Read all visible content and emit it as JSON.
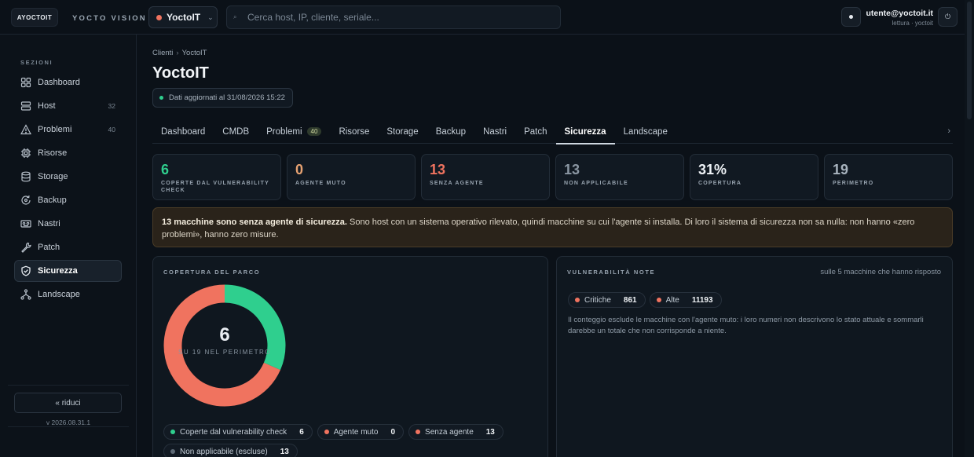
{
  "header": {
    "logo_text": "AYOCTOIT",
    "brand": "YOCTO VISION",
    "client": "YoctoIT",
    "search_placeholder": "Cerca host, IP, cliente, seriale...",
    "user_email": "utente@yoctoit.it",
    "user_role": "lettura · yoctoit"
  },
  "sidebar": {
    "section_title": "SEZIONI",
    "items": [
      {
        "label": "Dashboard",
        "icon": "grid-icon",
        "count": ""
      },
      {
        "label": "Host",
        "icon": "server-icon",
        "count": "32"
      },
      {
        "label": "Problemi",
        "icon": "warning-icon",
        "count": "40"
      },
      {
        "label": "Risorse",
        "icon": "cpu-icon",
        "count": ""
      },
      {
        "label": "Storage",
        "icon": "database-icon",
        "count": ""
      },
      {
        "label": "Backup",
        "icon": "backup-icon",
        "count": ""
      },
      {
        "label": "Nastri",
        "icon": "tape-icon",
        "count": ""
      },
      {
        "label": "Patch",
        "icon": "wrench-icon",
        "count": ""
      },
      {
        "label": "Sicurezza",
        "icon": "shield-icon",
        "count": ""
      },
      {
        "label": "Landscape",
        "icon": "network-icon",
        "count": ""
      }
    ],
    "active": "Sicurezza",
    "collapse_label": "« riduci",
    "version": "v 2026.08.31.1"
  },
  "main": {
    "breadcrumb": {
      "root": "Clienti",
      "current": "YoctoIT"
    },
    "title": "YoctoIT",
    "updated": "Dati aggiornati al 31/08/2026 15:22",
    "tabs": [
      {
        "label": "Dashboard",
        "badge": ""
      },
      {
        "label": "CMDB",
        "badge": ""
      },
      {
        "label": "Problemi",
        "badge": "40"
      },
      {
        "label": "Risorse",
        "badge": ""
      },
      {
        "label": "Storage",
        "badge": ""
      },
      {
        "label": "Backup",
        "badge": ""
      },
      {
        "label": "Nastri",
        "badge": ""
      },
      {
        "label": "Patch",
        "badge": ""
      },
      {
        "label": "Sicurezza",
        "badge": ""
      },
      {
        "label": "Landscape",
        "badge": ""
      }
    ],
    "active_tab": "Sicurezza",
    "stats": [
      {
        "value": "6",
        "label": "COPERTE DAL VULNERABILITY CHECK",
        "color": "#2fcf8e"
      },
      {
        "value": "0",
        "label": "AGENTE MUTO",
        "color": "#e7a272"
      },
      {
        "value": "13",
        "label": "SENZA AGENTE",
        "color": "#f0735f"
      },
      {
        "value": "13",
        "label": "NON APPLICABILE",
        "color": "#8a96a2"
      },
      {
        "value": "31%",
        "label": "COPERTURA",
        "color": "#eef2f6"
      },
      {
        "value": "19",
        "label": "PERIMETRO",
        "color": "#a8b3be"
      }
    ],
    "alert": {
      "bold": "13 macchine sono senza agente di sicurezza.",
      "text": " Sono host con un sistema operativo rilevato, quindi macchine su cui l'agente si installa. Di loro il sistema di sicurezza non sa nulla: non hanno «zero problemi», hanno zero misure."
    },
    "coverage": {
      "title": "COPERTURA DEL PARCO",
      "center_value": "6",
      "center_label": "SU 19 NEL PERIMETRO",
      "legend": [
        {
          "label": "Coperte dal vulnerability check",
          "value": "6",
          "color": "#2fcf8e"
        },
        {
          "label": "Agente muto",
          "value": "0",
          "color": "#f0735f"
        },
        {
          "label": "Senza agente",
          "value": "13",
          "color": "#f0735f"
        },
        {
          "label": "Non applicabile (escluse)",
          "value": "13",
          "color": "#5d6975"
        }
      ]
    },
    "vulns": {
      "title": "VULNERABILITÀ NOTE",
      "note_right": "sulle 5 macchine che hanno risposto",
      "chips": [
        {
          "label": "Critiche",
          "value": "861",
          "color": "#f0735f"
        },
        {
          "label": "Alte",
          "value": "11193",
          "color": "#f0735f"
        }
      ],
      "note": "Il conteggio esclude le macchine con l'agente muto: i loro numeri non descrivono lo stato attuale e sommarli darebbe un totale che non corrisponde a niente."
    }
  },
  "chart_data": {
    "type": "pie",
    "categories": [
      "Coperte dal vulnerability check",
      "Agente muto",
      "Senza agente"
    ],
    "values": [
      6,
      0,
      13
    ],
    "colors": [
      "#2fcf8e",
      "#e7a272",
      "#f0735f"
    ]
  }
}
